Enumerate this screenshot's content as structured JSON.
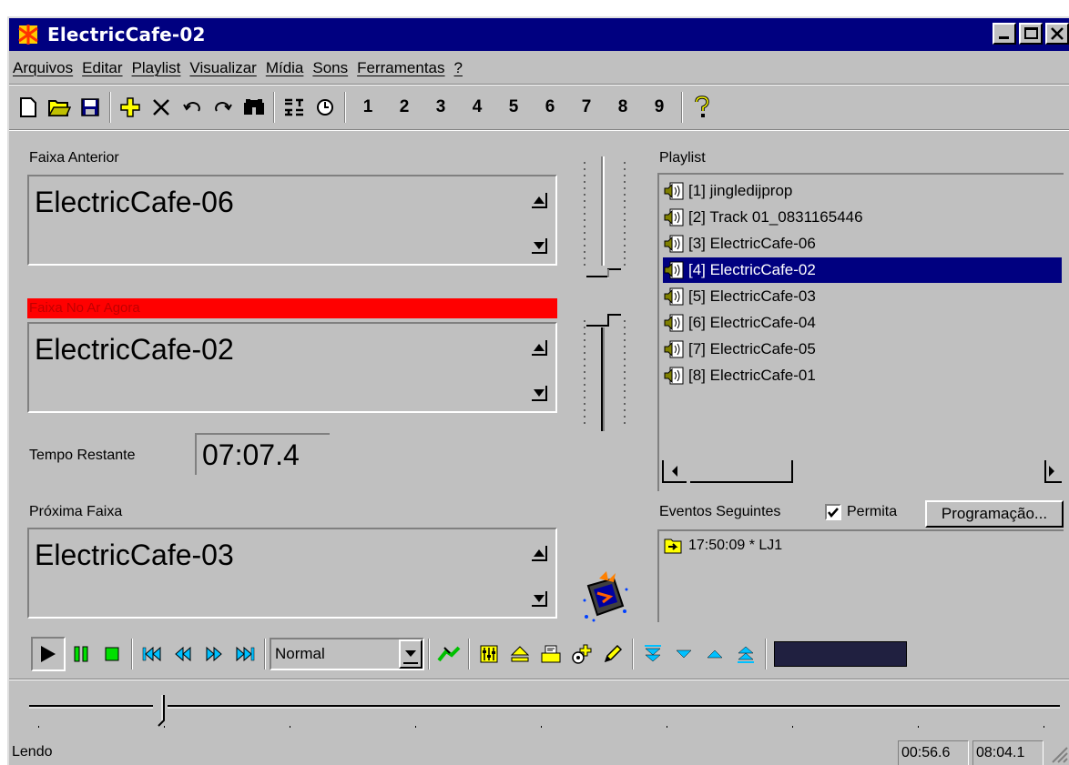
{
  "window": {
    "title": "ElectricCafe-02"
  },
  "menu": [
    "Arquivos",
    "Editar",
    "Playlist",
    "Visualizar",
    "Mídia",
    "Sons",
    "Ferramentas",
    "?"
  ],
  "toolbar": {
    "numbers": [
      "1",
      "2",
      "3",
      "4",
      "5",
      "6",
      "7",
      "8",
      "9"
    ]
  },
  "previous": {
    "label": "Faixa Anterior",
    "track": "ElectricCafe-06"
  },
  "now": {
    "label": "Faixa No Ar Agora",
    "track": "ElectricCafe-02"
  },
  "remaining": {
    "label": "Tempo Restante",
    "time": "07:07.4"
  },
  "next": {
    "label": "Próxima Faixa",
    "track": "ElectricCafe-03"
  },
  "playlist": {
    "label": "Playlist",
    "items": [
      "[1] jingledijprop",
      "[2] Track 01_0831165446",
      "[3] ElectricCafe-06",
      "[4] ElectricCafe-02",
      "[5] ElectricCafe-03",
      "[6] ElectricCafe-04",
      "[7] ElectricCafe-05",
      "[8] ElectricCafe-01"
    ],
    "selected_index": 3
  },
  "events": {
    "label": "Eventos Seguintes",
    "allow_label": "Permita",
    "allow_checked": true,
    "schedule_button": "Programação...",
    "items": [
      "17:50:09 * LJ1"
    ]
  },
  "transport": {
    "mode": "Normal"
  },
  "status": {
    "text": "Lendo",
    "elapsed": "00:56.6",
    "total": "08:04.1"
  },
  "colors": {
    "titlebar": "#000080",
    "on_air_bar": "#ff0000",
    "selection": "#000080",
    "toolbar_icons": "#ffff00",
    "transport_icons": "#00c0ff"
  }
}
